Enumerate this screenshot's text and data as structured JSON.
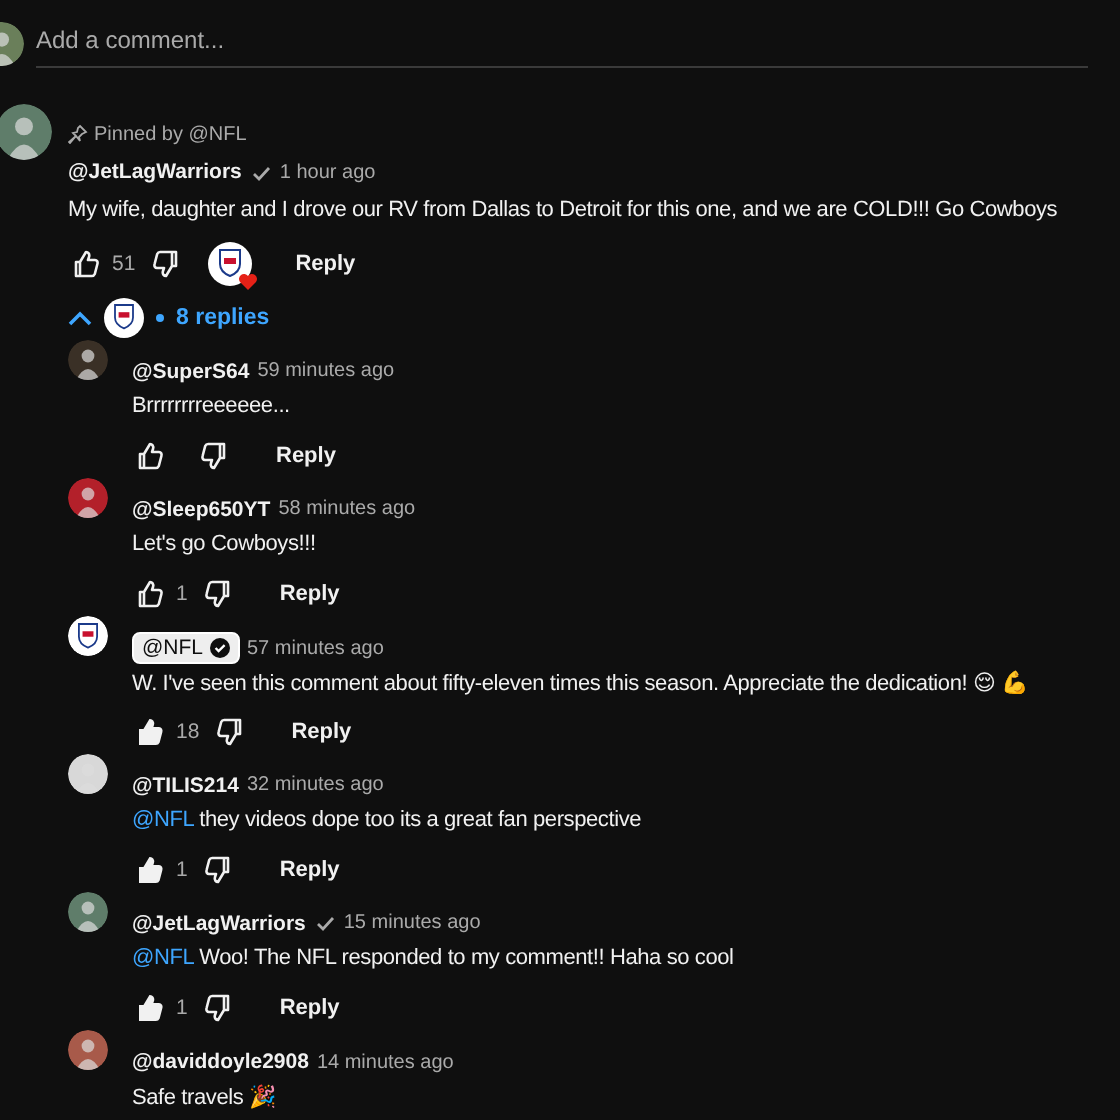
{
  "composer": {
    "placeholder": "Add a comment...",
    "avatar": {
      "kind": "photo",
      "color": "#6a7f5a"
    }
  },
  "comment": {
    "pinned_by": "Pinned by @NFL",
    "avatar": {
      "kind": "photo",
      "color": "#5f7d6a"
    },
    "author": "@JetLagWarriors",
    "verified": true,
    "time": "1 hour ago",
    "text": "My wife, daughter and I drove our RV from Dallas to Detroit for this one, and we are COLD!!! Go Cowboys",
    "likes": "51",
    "liked": false,
    "creator_heart": true,
    "reply_label": "Reply",
    "replies_toggle": {
      "expanded": true,
      "label": "8 replies"
    },
    "replies": [
      {
        "avatar": {
          "kind": "photo",
          "color": "#3a3026"
        },
        "author": "@SuperS64",
        "owner": false,
        "verified": false,
        "time": "59 minutes ago",
        "text": "Brrrrrrrreeeeee...",
        "liked": false,
        "reply_label": "Reply"
      },
      {
        "avatar": {
          "kind": "photo",
          "color": "#b3202a"
        },
        "author": "@Sleep650YT",
        "owner": false,
        "verified": false,
        "time": "58 minutes ago",
        "text": "Let's go Cowboys!!!",
        "likes": "1",
        "liked": false,
        "reply_label": "Reply"
      },
      {
        "avatar": {
          "kind": "logo"
        },
        "author": "@NFL",
        "owner": true,
        "verified": true,
        "time": "57 minutes ago",
        "text": "W. I've seen this comment about fifty-eleven times this season. Appreciate the dedication! 😌 💪",
        "likes": "18",
        "liked": true,
        "reply_label": "Reply"
      },
      {
        "avatar": {
          "kind": "photo",
          "color": "#d8d8d8"
        },
        "author": "@TILIS214",
        "owner": false,
        "verified": false,
        "time": "32 minutes ago",
        "mention": "@NFL",
        "text": "they videos dope too its a great fan perspective",
        "likes": "1",
        "liked": true,
        "reply_label": "Reply"
      },
      {
        "avatar": {
          "kind": "photo",
          "color": "#5f7d6a"
        },
        "author": "@JetLagWarriors",
        "owner": false,
        "verified": true,
        "time": "15 minutes ago",
        "mention": "@NFL",
        "text": "Woo! The NFL responded to my comment!! Haha so cool",
        "likes": "1",
        "liked": true,
        "reply_label": "Reply"
      },
      {
        "avatar": {
          "kind": "photo",
          "color": "#a85a4a"
        },
        "author": "@daviddoyle2908",
        "owner": false,
        "verified": false,
        "time": "14 minutes ago",
        "text": "Safe travels 🎉"
      }
    ]
  }
}
